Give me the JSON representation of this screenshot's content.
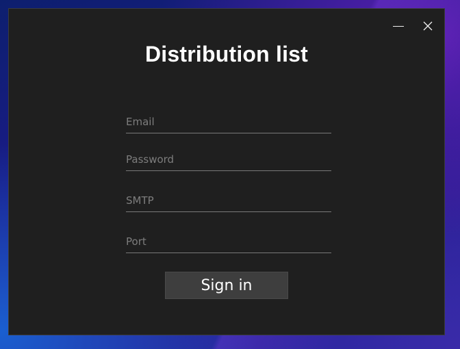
{
  "window": {
    "title": "Distribution list"
  },
  "form": {
    "email_placeholder": "Email",
    "password_placeholder": "Password",
    "smtp_placeholder": "SMTP",
    "port_placeholder": "Port",
    "submit_label": "Sign in"
  },
  "icons": {
    "minimize": "minimize-icon",
    "close": "close-icon"
  },
  "colors": {
    "window_bg": "#1f1f1f",
    "button_bg": "#3e3e3e",
    "text": "#ffffff",
    "placeholder": "#7d7d7d",
    "underline": "#7a7a7a"
  }
}
